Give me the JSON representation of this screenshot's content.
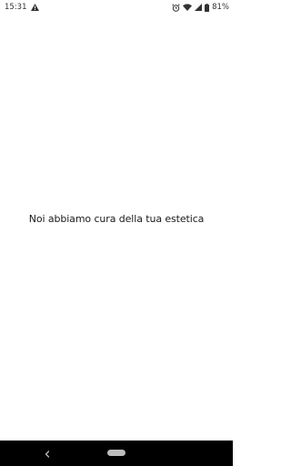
{
  "status_bar": {
    "time": "15:31",
    "battery_percent": "81%",
    "icons": [
      "alert-triangle-icon",
      "alarm-icon",
      "wifi-icon",
      "signal-icon",
      "battery-icon"
    ]
  },
  "main": {
    "tagline": "Noi abbiamo cura della tua estetica"
  },
  "nav_bar": {
    "icons": [
      "back-icon",
      "home-pill-icon"
    ]
  }
}
